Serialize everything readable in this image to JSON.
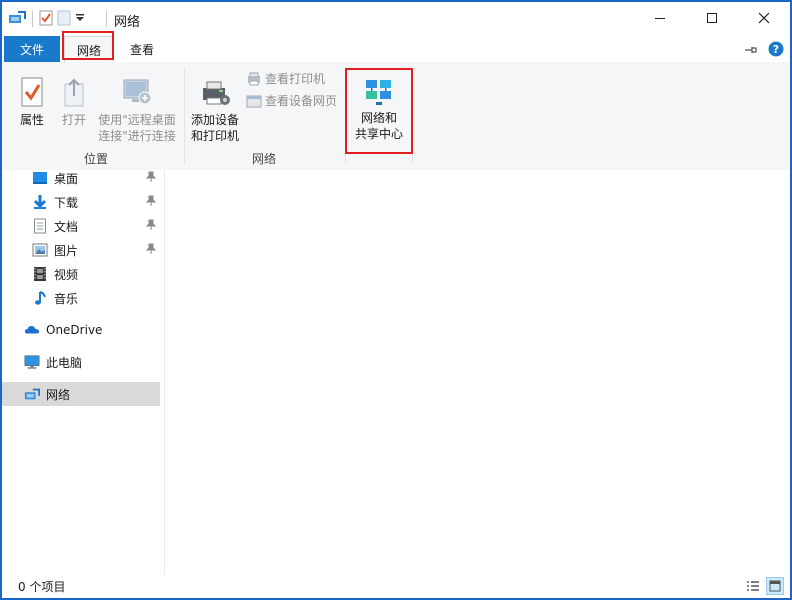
{
  "window": {
    "title": "网络"
  },
  "tabs": {
    "file": "文件",
    "network": "网络",
    "view": "查看"
  },
  "ribbon": {
    "location_group": {
      "label": "位置",
      "properties": "属性",
      "open": "打开",
      "remote_line1": "使用\"远程桌面",
      "remote_line2": "连接\"进行连接"
    },
    "network_group": {
      "label": "网络",
      "add_device_line1": "添加设备",
      "add_device_line2": "和打印机",
      "view_printers": "查看打印机",
      "view_device_page": "查看设备网页",
      "share_center_line1": "网络和",
      "share_center_line2": "共享中心"
    }
  },
  "nav": {
    "quick": [
      {
        "label": "桌面",
        "icon": "desktop-icon",
        "pinned": true
      },
      {
        "label": "下载",
        "icon": "download-icon",
        "pinned": true
      },
      {
        "label": "文档",
        "icon": "document-icon",
        "pinned": true
      },
      {
        "label": "图片",
        "icon": "pictures-icon",
        "pinned": true
      },
      {
        "label": "视频",
        "icon": "video-icon",
        "pinned": false
      },
      {
        "label": "音乐",
        "icon": "music-icon",
        "pinned": false
      }
    ],
    "onedrive": "OneDrive",
    "this_pc": "此电脑",
    "network": "网络"
  },
  "status": {
    "items_count": "0 个项目"
  },
  "colors": {
    "accent": "#1979ca",
    "highlight": "#e02020",
    "selected_bg": "#d9d9d9",
    "ribbon_bg": "#f5f6f7"
  }
}
